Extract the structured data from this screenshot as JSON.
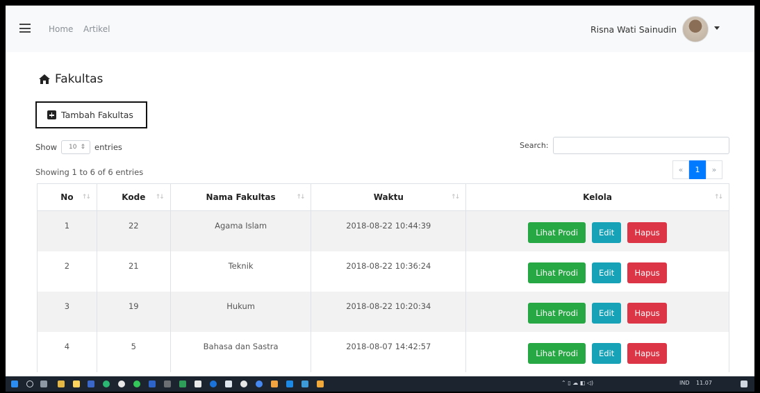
{
  "navbar": {
    "home_label": "Home",
    "artikel_label": "Artikel",
    "user_name": "Risna Wati Sainudin"
  },
  "page": {
    "title": "Fakultas"
  },
  "toolbar": {
    "add_label": "Tambah Fakultas"
  },
  "datatable": {
    "show_label": "Show",
    "length_value": "10",
    "entries_label": "entries",
    "search_label": "Search:",
    "search_value": "",
    "info": "Showing 1 to 6 of 6 entries",
    "pagination": {
      "prev": "«",
      "current": "1",
      "next": "»"
    }
  },
  "table": {
    "headers": [
      "No",
      "Kode",
      "Nama Fakultas",
      "Waktu",
      "Kelola"
    ],
    "rows": [
      {
        "no": "1",
        "kode": "22",
        "nama": "Agama Islam",
        "waktu": "2018-08-22 10:44:39"
      },
      {
        "no": "2",
        "kode": "21",
        "nama": "Teknik",
        "waktu": "2018-08-22 10:36:24"
      },
      {
        "no": "3",
        "kode": "19",
        "nama": "Hukum",
        "waktu": "2018-08-22 10:20:34"
      },
      {
        "no": "4",
        "kode": "5",
        "nama": "Bahasa dan Sastra",
        "waktu": "2018-08-07 14:42:57"
      }
    ],
    "actions": {
      "view": "Lihat Prodi",
      "edit": "Edit",
      "delete": "Hapus"
    }
  },
  "taskbar": {
    "lang": "IND",
    "time": "11.07"
  },
  "colors": {
    "view": "#28a745",
    "edit": "#17a2b8",
    "delete": "#dc3545",
    "page_active": "#007bff"
  }
}
